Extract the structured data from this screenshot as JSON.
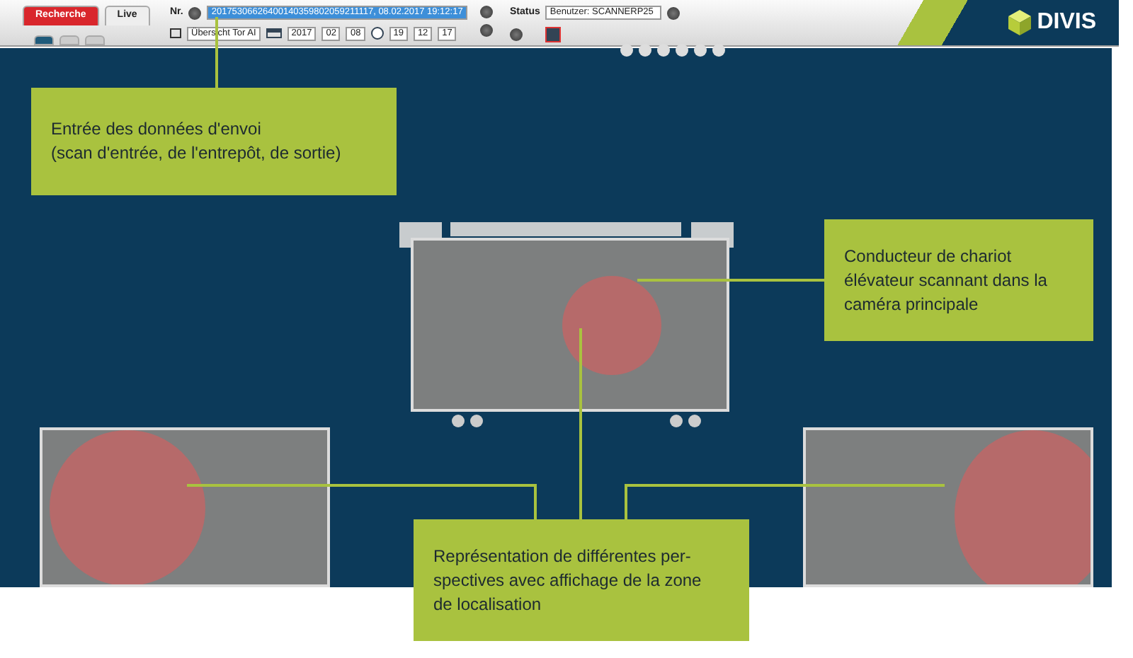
{
  "toolbar": {
    "mode_tabs": [
      {
        "label": "Recherche",
        "selected": true
      },
      {
        "label": "Live",
        "selected": false
      }
    ],
    "view_tabs": [
      {
        "selected": true
      },
      {
        "selected": false
      },
      {
        "selected": false
      }
    ],
    "number_label": "Nr.",
    "number_value": "20175306626400140359802059211117, 08.02.2017 19:12:17",
    "view_select": "Übersicht Tor AI",
    "date": [
      "2017",
      "02",
      "08"
    ],
    "time": [
      "19",
      "12",
      "17"
    ],
    "status_label": "Status",
    "status_select": "Benutzer: SCANNERP25"
  },
  "logo": {
    "text": "DIVIS"
  },
  "callouts": [
    {
      "lines": [
        "Entrée des données d'envoi",
        "(scan d'entrée, de l'entrepôt, de sortie)"
      ]
    },
    {
      "lines": [
        "Conducteur de chariot",
        "élévateur scannant dans la",
        "caméra principale"
      ]
    },
    {
      "lines": [
        "Représentation de différentes per-",
        "spectives avec affichage de la zone",
        "de localisation"
      ]
    }
  ]
}
